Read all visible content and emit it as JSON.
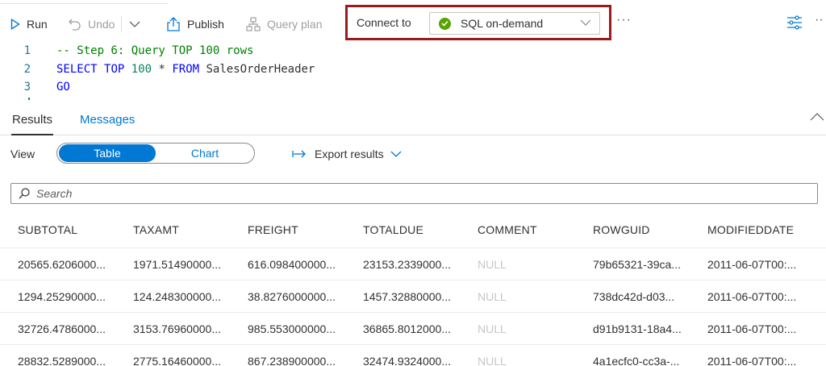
{
  "toolbar": {
    "run_label": "Run",
    "undo_label": "Undo",
    "publish_label": "Publish",
    "query_plan_label": "Query plan",
    "connect_to_label": "Connect to",
    "connection_value": "SQL on-demand",
    "more_label": "···",
    "more_right_label": "··"
  },
  "editor": {
    "lines": [
      {
        "number": "1",
        "text": "-- Step 6: Query TOP 100 rows"
      },
      {
        "number": "2",
        "kw1": "SELECT",
        "kw2": "TOP",
        "num": "100",
        "rest1": " * ",
        "kw3": "FROM",
        "rest2": " SalesOrderHeader"
      },
      {
        "number": "3",
        "kw": "GO"
      }
    ]
  },
  "results": {
    "tabs": {
      "results": "Results",
      "messages": "Messages"
    },
    "view_label": "View",
    "view_options": {
      "table": "Table",
      "chart": "Chart"
    },
    "export_label": "Export results",
    "search_placeholder": "Search"
  },
  "grid": {
    "columns": [
      "SUBTOTAL",
      "TAXAMT",
      "FREIGHT",
      "TOTALDUE",
      "COMMENT",
      "ROWGUID",
      "MODIFIEDDATE"
    ],
    "rows": [
      [
        "20565.6206000...",
        "1971.51490000...",
        "616.098400000...",
        "23153.2339000...",
        "NULL",
        "79b65321-39ca...",
        "2011-06-07T00:..."
      ],
      [
        "1294.25290000...",
        "124.248300000...",
        "38.8276000000...",
        "1457.32880000...",
        "NULL",
        "738dc42d-d03...",
        "2011-06-07T00:..."
      ],
      [
        "32726.4786000...",
        "3153.76960000...",
        "985.553000000...",
        "36865.8012000...",
        "NULL",
        "d91b9131-18a4...",
        "2011-06-07T00:..."
      ],
      [
        "28832.5289000...",
        "2775.16460000...",
        "867.238900000...",
        "32474.9324000...",
        "NULL",
        "4a1ecfc0-cc3a-...",
        "2011-06-07T00:..."
      ]
    ]
  },
  "colors": {
    "accent": "#0078d4",
    "connect_highlight": "#9b1a1a",
    "status_ok": "#57a300"
  },
  "icons": [
    "run-icon",
    "undo-icon",
    "chevron-down-icon",
    "publish-icon",
    "query-plan-icon",
    "check-circle-icon",
    "filter-settings-icon",
    "chevron-up-icon",
    "export-arrow-icon",
    "search-icon"
  ]
}
